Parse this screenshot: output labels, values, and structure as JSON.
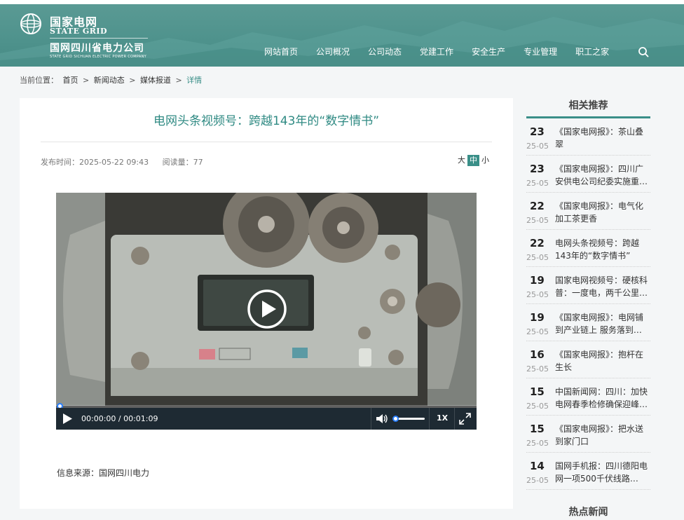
{
  "header": {
    "logo_cn": "国家电网",
    "logo_en": "STATE GRID",
    "logo_sub": "国网四川省电力公司",
    "logo_sub_en": "STATE GRID SICHUAN ELECTRIC POWER COMPANY",
    "nav": [
      "网站首页",
      "公司概况",
      "公司动态",
      "党建工作",
      "安全生产",
      "专业管理",
      "职工之家"
    ],
    "search_icon": "search-icon"
  },
  "breadcrumb": {
    "prefix": "当前位置：",
    "items": [
      "首页",
      "新闻动态",
      "媒体报道"
    ],
    "separator": ">",
    "current": "详情"
  },
  "article": {
    "title": "电网头条视频号：跨越143年的“数字情书”",
    "publish_time": "发布时间：2025-05-22 09:43",
    "read_count": "阅读量：77",
    "font_sizes": [
      "大",
      "中",
      "小"
    ],
    "font_size_active": "中",
    "source": "信息来源：国网四川电力"
  },
  "video": {
    "time": "00:00:00 / 00:01:09",
    "speed": "1X",
    "progress": 0,
    "volume": 0
  },
  "sidebar": {
    "title": "相关推荐",
    "items": [
      {
        "day": "23",
        "month": "25-05",
        "text": "《国家电网报》：茶山叠翠"
      },
      {
        "day": "23",
        "month": "25-05",
        "text": "《国家电网报》：四川广安供电公司纪委实施重…"
      },
      {
        "day": "22",
        "month": "25-05",
        "text": "《国家电网报》：电气化加工茶更香"
      },
      {
        "day": "22",
        "month": "25-05",
        "text": "电网头条视频号：跨越143年的“数字情书”"
      },
      {
        "day": "19",
        "month": "25-05",
        "text": "国家电网视频号：硬核科普：一度电，两千公里…"
      },
      {
        "day": "19",
        "month": "25-05",
        "text": "《国家电网报》：电网铺到产业链上 服务落到…"
      },
      {
        "day": "16",
        "month": "25-05",
        "text": "《国家电网报》：抱杆在生长"
      },
      {
        "day": "15",
        "month": "25-05",
        "text": "中国新闻网：四川：加快电网春季检修确保迎峰…"
      },
      {
        "day": "15",
        "month": "25-05",
        "text": "《国家电网报》：把水送到家门口"
      },
      {
        "day": "14",
        "month": "25-05",
        "text": "国网手机报：四川德阳电网一项500千伏线路…"
      }
    ],
    "hot_title": "热点新闻"
  },
  "colors": {
    "accent": "#3a8f88",
    "header_bg": "#4e928c"
  }
}
